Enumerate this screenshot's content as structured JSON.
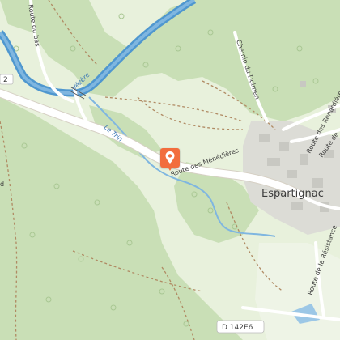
{
  "map": {
    "place_labels": {
      "village": "Espartignac"
    },
    "road_labels": {
      "route_meneres": "Route des Ménédières",
      "route_bas": "Route du bas",
      "chemin_dolmen": "Chemin du Dolmen",
      "route_renardieres": "Route des Renardières",
      "route_resistance": "Route de la Résistance",
      "route_right": "Route de",
      "road_left_number": "2",
      "road_shield": "D 142E6",
      "left_edge_text": "d"
    },
    "water_labels": {
      "vezere": "Vézère",
      "le_trin": "Le Trin"
    },
    "marker": {
      "icon": "location-pin-icon",
      "color": "#f26d3d"
    },
    "colors": {
      "forest": "#c9dfb6",
      "meadow": "#e8f1dc",
      "river": "#4f97cf",
      "road": "#ffffff",
      "path": "#b08a63",
      "village": "#d8d8d8"
    }
  }
}
